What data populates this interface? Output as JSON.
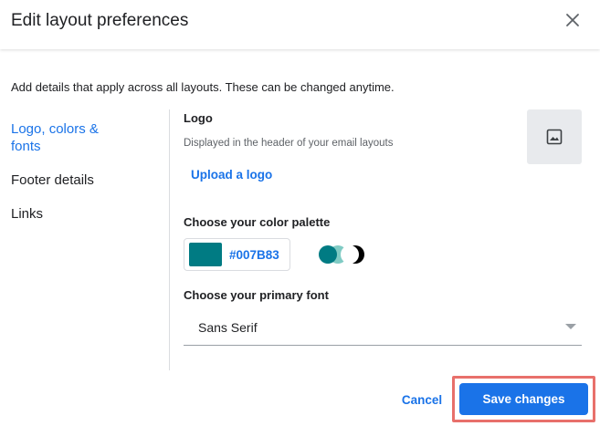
{
  "dialog": {
    "title": "Edit layout preferences",
    "intro": "Add details that apply across all layouts. These can be changed anytime."
  },
  "sidebar": {
    "items": [
      {
        "label": "Logo, colors & fonts",
        "active": true
      },
      {
        "label": "Footer details",
        "active": false
      },
      {
        "label": "Links",
        "active": false
      }
    ]
  },
  "logo": {
    "label": "Logo",
    "description": "Displayed in the header of your email layouts",
    "upload_label": "Upload a logo",
    "placeholder_icon": "image-icon"
  },
  "palette": {
    "label": "Choose your color palette",
    "hex": "#007B83",
    "swatch_color": "#007B83",
    "toggle_colors": [
      "#007B83",
      "#80CBC4",
      "#000000"
    ]
  },
  "font": {
    "label": "Choose your primary font",
    "value": "Sans Serif"
  },
  "footer": {
    "cancel_label": "Cancel",
    "save_label": "Save changes"
  },
  "colors": {
    "accent": "#1a73e8",
    "highlight_outline": "#e8706b"
  }
}
